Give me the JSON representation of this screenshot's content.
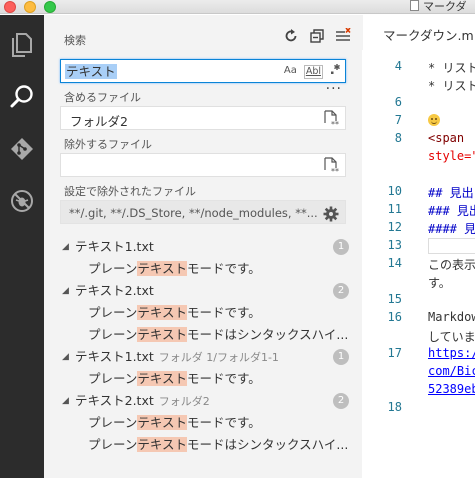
{
  "window": {
    "title": "マークダ"
  },
  "activity_bar": {
    "items": [
      {
        "name": "explorer",
        "icon": "files-icon"
      },
      {
        "name": "search",
        "icon": "search-icon",
        "active": true
      },
      {
        "name": "git",
        "icon": "git-icon"
      },
      {
        "name": "debug",
        "icon": "debug-icon"
      }
    ]
  },
  "sidebar": {
    "title": "検索",
    "search": {
      "value": "テキスト",
      "options": {
        "case": "Aa",
        "word": "Abl",
        "regex": ".*"
      }
    },
    "include": {
      "label": "含めるファイル",
      "value": "フォルダ2"
    },
    "exclude": {
      "label": "除外するファイル",
      "value": ""
    },
    "settings_exclude": {
      "label": "設定で除外されたファイル",
      "value": "**/.git, **/.DS_Store, **/node_modules, **..."
    },
    "results": [
      {
        "file": "テキスト1.txt",
        "path": "",
        "count": "1",
        "matches": [
          {
            "pre": "プレーン",
            "hit": "テキスト",
            "post": "モードです。"
          }
        ]
      },
      {
        "file": "テキスト2.txt",
        "path": "",
        "count": "2",
        "matches": [
          {
            "pre": "プレーン",
            "hit": "テキスト",
            "post": "モードです。"
          },
          {
            "pre": "プレーン",
            "hit": "テキスト",
            "post": "モードはシンタックスハイ..."
          }
        ]
      },
      {
        "file": "テキスト1.txt",
        "path": "フォルダ 1/フォルダ1-1",
        "count": "1",
        "matches": [
          {
            "pre": "プレーン",
            "hit": "テキスト",
            "post": "モードです。"
          }
        ]
      },
      {
        "file": "テキスト2.txt",
        "path": "フォルダ2",
        "count": "2",
        "matches": [
          {
            "pre": "プレーン",
            "hit": "テキスト",
            "post": "モードです。"
          },
          {
            "pre": "プレーン",
            "hit": "テキスト",
            "post": "モードはシンタックスハイ..."
          }
        ]
      }
    ]
  },
  "editor": {
    "tab": "マークダウン.m",
    "lines": [
      {
        "n": "4",
        "text": "* リスト",
        "style": ""
      },
      {
        "n": "",
        "text": "* リスト",
        "style": ""
      },
      {
        "n": "6",
        "text": "",
        "style": ""
      },
      {
        "n": "7",
        "text": "",
        "style": "emoji"
      },
      {
        "n": "8",
        "text": "<span",
        "style": "maroon"
      },
      {
        "n": "",
        "text": "style=\"",
        "style": "red"
      },
      {
        "n": "10",
        "text": "## 見出",
        "style": "blue"
      },
      {
        "n": "11",
        "text": "### 見出",
        "style": "blue"
      },
      {
        "n": "12",
        "text": "#### 見",
        "style": "blue"
      },
      {
        "n": "13",
        "text": "",
        "style": "box"
      },
      {
        "n": "14",
        "text": "この表示",
        "style": ""
      },
      {
        "n": "",
        "text": "す。",
        "style": ""
      },
      {
        "n": "15",
        "text": "",
        "style": ""
      },
      {
        "n": "16",
        "text": "Markdow",
        "style": ""
      },
      {
        "n": "",
        "text": "していま",
        "style": ""
      },
      {
        "n": "17",
        "text": "https:/",
        "style": "link"
      },
      {
        "n": "",
        "text": "com/Bic",
        "style": "link"
      },
      {
        "n": "",
        "text": "52389eb",
        "style": "link"
      },
      {
        "n": "18",
        "text": "",
        "style": ""
      }
    ]
  },
  "colors": {
    "accent": "#0a84d6",
    "highlight": "#f5c8b3",
    "activity_bg": "#2c2c2c",
    "sidebar_bg": "#f3f3f3"
  }
}
